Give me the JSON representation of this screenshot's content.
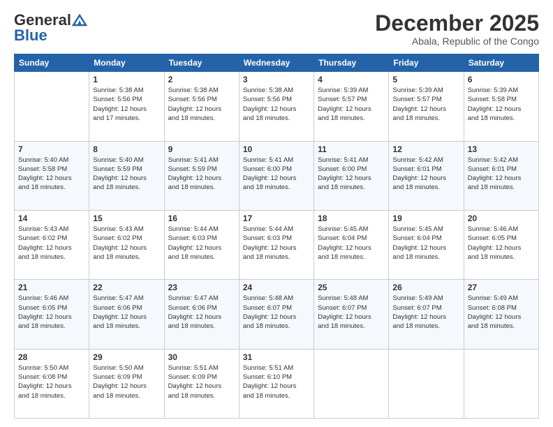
{
  "logo": {
    "general": "General",
    "blue": "Blue"
  },
  "header": {
    "month": "December 2025",
    "location": "Abala, Republic of the Congo"
  },
  "weekdays": [
    "Sunday",
    "Monday",
    "Tuesday",
    "Wednesday",
    "Thursday",
    "Friday",
    "Saturday"
  ],
  "weeks": [
    [
      {
        "day": "",
        "info": ""
      },
      {
        "day": "1",
        "info": "Sunrise: 5:38 AM\nSunset: 5:56 PM\nDaylight: 12 hours\nand 17 minutes."
      },
      {
        "day": "2",
        "info": "Sunrise: 5:38 AM\nSunset: 5:56 PM\nDaylight: 12 hours\nand 18 minutes."
      },
      {
        "day": "3",
        "info": "Sunrise: 5:38 AM\nSunset: 5:56 PM\nDaylight: 12 hours\nand 18 minutes."
      },
      {
        "day": "4",
        "info": "Sunrise: 5:39 AM\nSunset: 5:57 PM\nDaylight: 12 hours\nand 18 minutes."
      },
      {
        "day": "5",
        "info": "Sunrise: 5:39 AM\nSunset: 5:57 PM\nDaylight: 12 hours\nand 18 minutes."
      },
      {
        "day": "6",
        "info": "Sunrise: 5:39 AM\nSunset: 5:58 PM\nDaylight: 12 hours\nand 18 minutes."
      }
    ],
    [
      {
        "day": "7",
        "info": "Sunrise: 5:40 AM\nSunset: 5:58 PM\nDaylight: 12 hours\nand 18 minutes."
      },
      {
        "day": "8",
        "info": "Sunrise: 5:40 AM\nSunset: 5:59 PM\nDaylight: 12 hours\nand 18 minutes."
      },
      {
        "day": "9",
        "info": "Sunrise: 5:41 AM\nSunset: 5:59 PM\nDaylight: 12 hours\nand 18 minutes."
      },
      {
        "day": "10",
        "info": "Sunrise: 5:41 AM\nSunset: 6:00 PM\nDaylight: 12 hours\nand 18 minutes."
      },
      {
        "day": "11",
        "info": "Sunrise: 5:41 AM\nSunset: 6:00 PM\nDaylight: 12 hours\nand 18 minutes."
      },
      {
        "day": "12",
        "info": "Sunrise: 5:42 AM\nSunset: 6:01 PM\nDaylight: 12 hours\nand 18 minutes."
      },
      {
        "day": "13",
        "info": "Sunrise: 5:42 AM\nSunset: 6:01 PM\nDaylight: 12 hours\nand 18 minutes."
      }
    ],
    [
      {
        "day": "14",
        "info": "Sunrise: 5:43 AM\nSunset: 6:02 PM\nDaylight: 12 hours\nand 18 minutes."
      },
      {
        "day": "15",
        "info": "Sunrise: 5:43 AM\nSunset: 6:02 PM\nDaylight: 12 hours\nand 18 minutes."
      },
      {
        "day": "16",
        "info": "Sunrise: 5:44 AM\nSunset: 6:03 PM\nDaylight: 12 hours\nand 18 minutes."
      },
      {
        "day": "17",
        "info": "Sunrise: 5:44 AM\nSunset: 6:03 PM\nDaylight: 12 hours\nand 18 minutes."
      },
      {
        "day": "18",
        "info": "Sunrise: 5:45 AM\nSunset: 6:04 PM\nDaylight: 12 hours\nand 18 minutes."
      },
      {
        "day": "19",
        "info": "Sunrise: 5:45 AM\nSunset: 6:04 PM\nDaylight: 12 hours\nand 18 minutes."
      },
      {
        "day": "20",
        "info": "Sunrise: 5:46 AM\nSunset: 6:05 PM\nDaylight: 12 hours\nand 18 minutes."
      }
    ],
    [
      {
        "day": "21",
        "info": "Sunrise: 5:46 AM\nSunset: 6:05 PM\nDaylight: 12 hours\nand 18 minutes."
      },
      {
        "day": "22",
        "info": "Sunrise: 5:47 AM\nSunset: 6:06 PM\nDaylight: 12 hours\nand 18 minutes."
      },
      {
        "day": "23",
        "info": "Sunrise: 5:47 AM\nSunset: 6:06 PM\nDaylight: 12 hours\nand 18 minutes."
      },
      {
        "day": "24",
        "info": "Sunrise: 5:48 AM\nSunset: 6:07 PM\nDaylight: 12 hours\nand 18 minutes."
      },
      {
        "day": "25",
        "info": "Sunrise: 5:48 AM\nSunset: 6:07 PM\nDaylight: 12 hours\nand 18 minutes."
      },
      {
        "day": "26",
        "info": "Sunrise: 5:49 AM\nSunset: 6:07 PM\nDaylight: 12 hours\nand 18 minutes."
      },
      {
        "day": "27",
        "info": "Sunrise: 5:49 AM\nSunset: 6:08 PM\nDaylight: 12 hours\nand 18 minutes."
      }
    ],
    [
      {
        "day": "28",
        "info": "Sunrise: 5:50 AM\nSunset: 6:08 PM\nDaylight: 12 hours\nand 18 minutes."
      },
      {
        "day": "29",
        "info": "Sunrise: 5:50 AM\nSunset: 6:09 PM\nDaylight: 12 hours\nand 18 minutes."
      },
      {
        "day": "30",
        "info": "Sunrise: 5:51 AM\nSunset: 6:09 PM\nDaylight: 12 hours\nand 18 minutes."
      },
      {
        "day": "31",
        "info": "Sunrise: 5:51 AM\nSunset: 6:10 PM\nDaylight: 12 hours\nand 18 minutes."
      },
      {
        "day": "",
        "info": ""
      },
      {
        "day": "",
        "info": ""
      },
      {
        "day": "",
        "info": ""
      }
    ]
  ]
}
